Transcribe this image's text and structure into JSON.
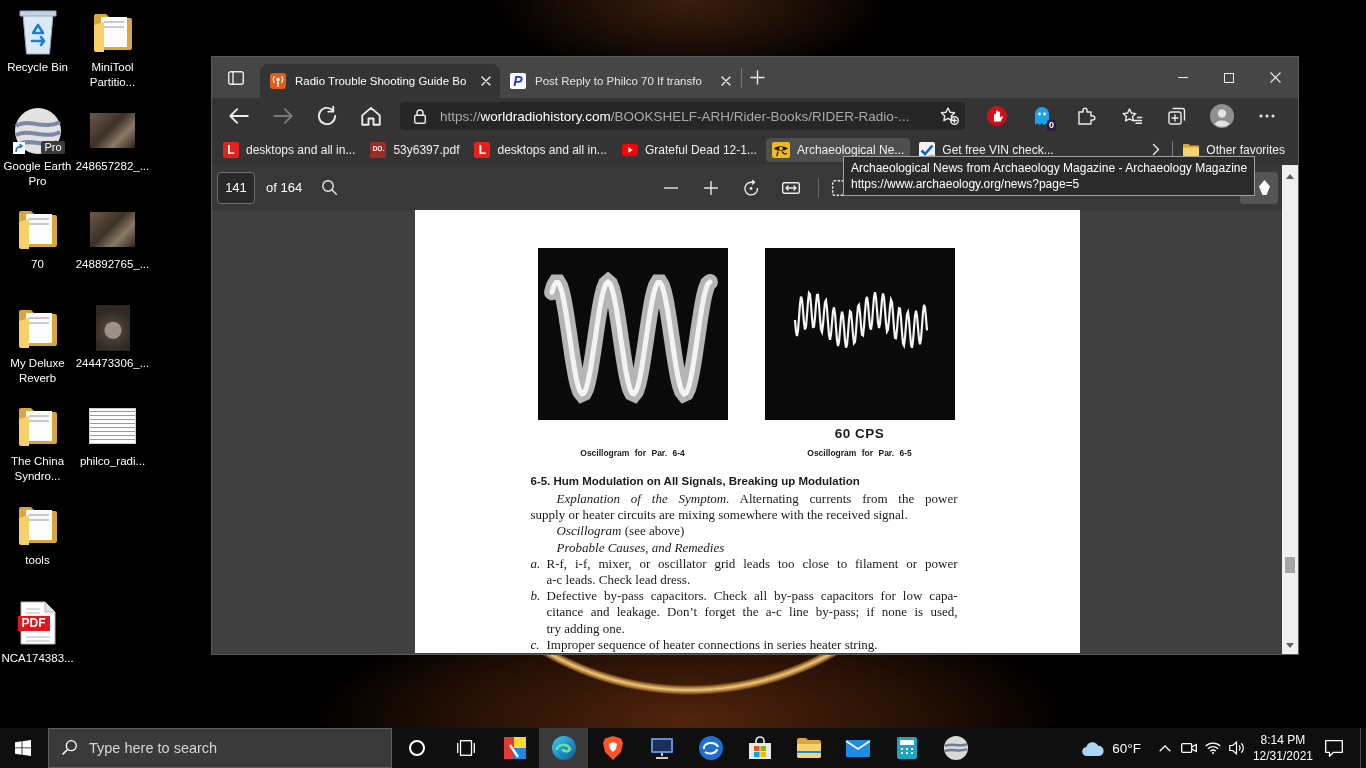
{
  "desktop": {
    "icons": [
      {
        "label": "Recycle Bin",
        "kind": "recycle-bin",
        "shortcut": false
      },
      {
        "label": "Google Earth Pro",
        "kind": "globe",
        "badge": "Pro",
        "shortcut": true
      },
      {
        "label": "70",
        "kind": "folder",
        "shortcut": false
      },
      {
        "label": "My Deluxe Reverb",
        "kind": "folder",
        "shortcut": false
      },
      {
        "label": "The China Syndro...",
        "kind": "folder",
        "shortcut": false
      },
      {
        "label": "tools",
        "kind": "folder",
        "shortcut": false
      },
      {
        "label": "NCA174383...",
        "kind": "pdf",
        "badge": "PDF",
        "shortcut": false
      },
      {
        "label": "MiniTool Partitio...",
        "kind": "folder",
        "shortcut": false
      },
      {
        "label": "248657282_...",
        "kind": "photo",
        "shortcut": false
      },
      {
        "label": "248892765_...",
        "kind": "photo",
        "shortcut": false
      },
      {
        "label": "244473306_...",
        "kind": "portrait-photo",
        "shortcut": false
      },
      {
        "label": "philco_radi...",
        "kind": "schematic",
        "shortcut": false
      }
    ]
  },
  "browser": {
    "tabs": [
      {
        "title": "Radio Trouble Shooting Guide Bo",
        "kind": "radio",
        "selected": true
      },
      {
        "title": "Post Reply to Philco 70 If transfo",
        "kind": "italic-letter",
        "logo_text": "P",
        "selected": false
      }
    ],
    "nav": [
      {
        "kind": "back",
        "disabled": false
      },
      {
        "kind": "forward",
        "disabled": true
      },
      {
        "kind": "refresh",
        "disabled": false
      },
      {
        "kind": "home",
        "disabled": false
      }
    ],
    "address": {
      "scheme": "https://",
      "host": "worldradiohistory.com",
      "path": "/BOOKSHELF-ARH/Rider-Books/RIDER-Radio-..."
    },
    "extensions": [
      {
        "kind": "hand"
      },
      {
        "kind": "ghost",
        "badge": "0"
      },
      {
        "kind": "puzzle"
      },
      {
        "kind": "favorites"
      },
      {
        "kind": "collections"
      },
      {
        "kind": "profile"
      },
      {
        "kind": "more"
      }
    ],
    "favorites": [
      {
        "label": "desktops and all in...",
        "kind": "letter",
        "logo_text": "L",
        "hovered": false
      },
      {
        "label": "53y6397.pdf",
        "kind": "stamp",
        "logo_text": "DO.",
        "hovered": false
      },
      {
        "label": "desktops and all in...",
        "kind": "letter",
        "logo_text": "L",
        "hovered": false
      },
      {
        "label": "Grateful Dead 12-1...",
        "kind": "play",
        "hovered": false
      },
      {
        "label": "Archaeological Ne...",
        "kind": "eye",
        "hovered": true
      },
      {
        "label": "Get free VIN check...",
        "kind": "check",
        "hovered": false
      }
    ],
    "other_favorites": "Other favorites",
    "tooltip": {
      "title": "Archaeological News from Archaeology Magazine - Archaeology Magazine",
      "url": "https://www.archaeology.org/news?page=5"
    }
  },
  "pdf": {
    "page": "141",
    "total": "of 164",
    "tools": [
      {
        "kind": "zoom-out"
      },
      {
        "kind": "zoom-in"
      },
      {
        "kind": "rotate"
      },
      {
        "kind": "fit-width"
      },
      {
        "kind": "page-view"
      }
    ],
    "document": {
      "figures": [
        {
          "kind": "thick-sine",
          "caption": "Oscillogram for Par. 6-4"
        },
        {
          "kind": "ripple",
          "label": "60 CPS",
          "caption": "Oscillogram for Par. 6-5"
        }
      ],
      "heading": "6-5. Hum Modulation on All Signals, Breaking up Modulation",
      "blocks": [
        {
          "kind": "paragraph",
          "lines": [
            "*Explanation of the Symptom.* Alternating currents from the power",
            "supply or heater circuits are mixing somewhere with the received signal."
          ]
        },
        {
          "kind": "paragraph",
          "lines": [
            "*Oscillogram* (see above)"
          ]
        },
        {
          "kind": "subhead",
          "lines": [
            "Probable Causes, and Remedies"
          ]
        },
        {
          "kind": "item",
          "marker": "a.",
          "lines": [
            "R-f, i-f, mixer, or oscillator grid leads too close to filament or power",
            "a-c leads. Check lead dress."
          ]
        },
        {
          "kind": "item",
          "marker": "b.",
          "lines": [
            "Defective by-pass capacitors. Check all by-pass capacitors for low capa-",
            "citance and leakage. Don’t forget the a-c line by-pass; if none is used,",
            "try adding one."
          ]
        },
        {
          "kind": "item",
          "marker": "c.",
          "lines": [
            "Improper sequence of heater connections in series heater string."
          ]
        }
      ]
    }
  },
  "taskbar": {
    "search": {
      "placeholder": "Type here to search"
    },
    "apps": [
      {
        "kind": "cortana",
        "active": false
      },
      {
        "kind": "task-view",
        "active": false
      },
      {
        "kind": "color-blocks",
        "active": false
      },
      {
        "kind": "swirl",
        "active": true
      },
      {
        "kind": "shield",
        "active": false
      },
      {
        "kind": "monitor",
        "active": false
      },
      {
        "kind": "orb",
        "active": false
      },
      {
        "kind": "store",
        "active": false
      },
      {
        "kind": "folder",
        "active": false
      },
      {
        "kind": "mail",
        "active": false
      },
      {
        "kind": "calculator",
        "active": false
      },
      {
        "kind": "globe",
        "active": false
      }
    ],
    "weather": {
      "temperature": "60°F"
    },
    "tray": [
      {
        "kind": "chevron"
      },
      {
        "kind": "camera"
      },
      {
        "kind": "wifi"
      },
      {
        "kind": "volume"
      }
    ],
    "time": "8:14 PM",
    "date": "12/31/2021"
  }
}
